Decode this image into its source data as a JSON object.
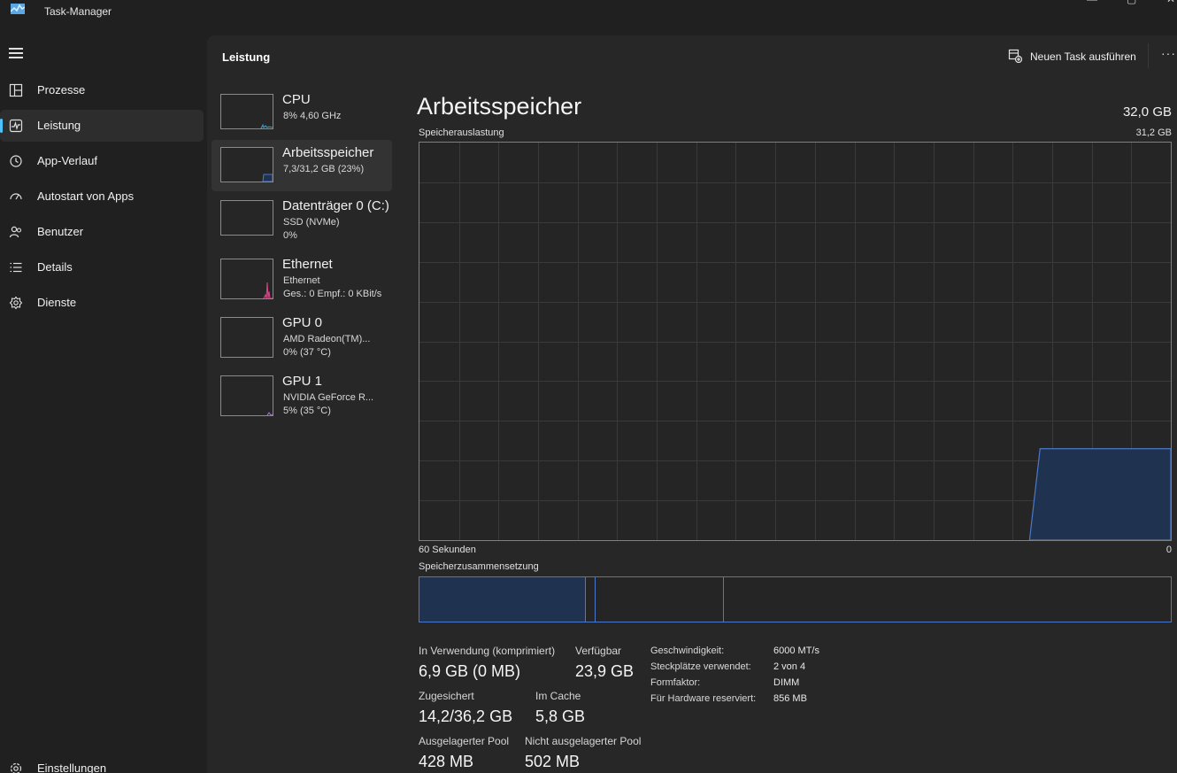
{
  "window": {
    "title": "Task-Manager"
  },
  "sidebar": {
    "items": [
      {
        "label": "Prozesse",
        "icon": "processes-icon"
      },
      {
        "label": "Leistung",
        "icon": "performance-icon",
        "active": true
      },
      {
        "label": "App-Verlauf",
        "icon": "history-icon"
      },
      {
        "label": "Autostart von Apps",
        "icon": "startup-icon"
      },
      {
        "label": "Benutzer",
        "icon": "users-icon"
      },
      {
        "label": "Details",
        "icon": "details-icon"
      },
      {
        "label": "Dienste",
        "icon": "services-icon"
      }
    ],
    "settings_label": "Einstellungen"
  },
  "header": {
    "title": "Leistung",
    "run_task_label": "Neuen Task ausführen",
    "more_label": "···"
  },
  "resources": [
    {
      "name": "CPU",
      "sub1": "8% 4,60 GHz",
      "sub2": ""
    },
    {
      "name": "Arbeitsspeicher",
      "sub1": "7,3/31,2 GB (23%)",
      "sub2": "",
      "active": true
    },
    {
      "name": "Datenträger 0 (C:)",
      "sub1": "SSD (NVMe)",
      "sub2": "0%"
    },
    {
      "name": "Ethernet",
      "sub1": "Ethernet",
      "sub2": "Ges.: 0 Empf.: 0 KBit/s"
    },
    {
      "name": "GPU 0",
      "sub1": "AMD Radeon(TM)...",
      "sub2": "0% (37 °C)"
    },
    {
      "name": "GPU 1",
      "sub1": "NVIDIA GeForce R...",
      "sub2": "5% (35 °C)"
    }
  ],
  "detail": {
    "title": "Arbeitsspeicher",
    "total": "32,0 GB",
    "usage_label": "Speicherauslastung",
    "usage_max": "31,2 GB",
    "time_left": "60 Sekunden",
    "time_right": "0",
    "composition_label": "Speicherzusammensetzung",
    "usage_fraction_now": 0.23,
    "composition_fractions": {
      "in_use": 0.221,
      "modified": 0.013,
      "standby": 0.171,
      "free": 0.595
    },
    "stats": {
      "in_use_label": "In Verwendung (komprimiert)",
      "in_use_value": "6,9 GB (0 MB)",
      "available_label": "Verfügbar",
      "available_value": "23,9 GB",
      "committed_label": "Zugesichert",
      "committed_value": "14,2/36,2 GB",
      "cached_label": "Im Cache",
      "cached_value": "5,8 GB",
      "paged_label": "Ausgelagerter Pool",
      "paged_value": "428 MB",
      "nonpaged_label": "Nicht ausgelagerter Pool",
      "nonpaged_value": "502 MB"
    },
    "specs": [
      {
        "key": "Geschwindigkeit:",
        "value": "6000 MT/s"
      },
      {
        "key": "Steckplätze verwendet:",
        "value": "2 von 4"
      },
      {
        "key": "Formfaktor:",
        "value": "DIMM"
      },
      {
        "key": "Für Hardware reserviert:",
        "value": "856 MB"
      }
    ]
  },
  "colors": {
    "accent": "#4cc2ff",
    "memory_line": "#4c78c9",
    "memory_fill": "#1f3250",
    "ethernet": "#d9478a"
  }
}
